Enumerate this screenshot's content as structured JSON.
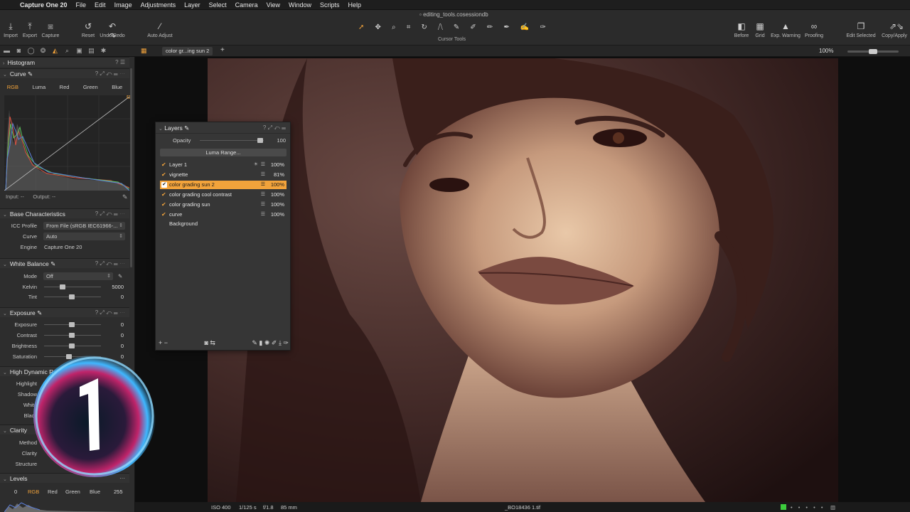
{
  "menubar": {
    "app": "Capture One 20",
    "items": [
      "File",
      "Edit",
      "Image",
      "Adjustments",
      "Layer",
      "Select",
      "Camera",
      "View",
      "Window",
      "Scripts",
      "Help"
    ]
  },
  "document_title": "editing_tools.cosessiondb",
  "toolbar": {
    "left": [
      {
        "label": "Import",
        "icon": "import-icon"
      },
      {
        "label": "Export",
        "icon": "export-icon"
      },
      {
        "label": "Capture",
        "icon": "camera-icon"
      },
      {
        "label": "Reset",
        "icon": "reset-icon"
      },
      {
        "label": "Undo/Redo",
        "icon": "undo-icon"
      },
      {
        "label": "Auto Adjust",
        "icon": "wand-icon"
      }
    ],
    "cursor_tools_label": "Cursor Tools",
    "right": [
      {
        "label": "Before",
        "icon": "before-icon"
      },
      {
        "label": "Grid",
        "icon": "grid-icon"
      },
      {
        "label": "Exp. Warning",
        "icon": "warning-icon"
      },
      {
        "label": "Proofing",
        "icon": "glasses-icon"
      },
      {
        "label": "Edit Selected",
        "icon": "stack-icon"
      },
      {
        "label": "Copy/Apply",
        "icon": "arrows-icon"
      }
    ]
  },
  "viewer": {
    "tab_label": "color gr...ing sun 2",
    "zoom": "100%"
  },
  "sidebar": {
    "histogram": "Histogram",
    "curve": {
      "title": "Curve",
      "tabs": [
        "RGB",
        "Luma",
        "Red",
        "Green",
        "Blue"
      ],
      "input_label": "Input:",
      "input_value": "--",
      "output_label": "Output:",
      "output_value": "--"
    },
    "base": {
      "title": "Base Characteristics",
      "icc_label": "ICC Profile",
      "icc_value": "From File (sRGB IEC61966-...",
      "curve_label": "Curve",
      "curve_value": "Auto",
      "engine_label": "Engine",
      "engine_value": "Capture One 20"
    },
    "white_balance": {
      "title": "White Balance",
      "mode_label": "Mode",
      "mode_value": "Off",
      "kelvin_label": "Kelvin",
      "kelvin_value": "5000",
      "tint_label": "Tint",
      "tint_value": "0"
    },
    "exposure": {
      "title": "Exposure",
      "rows": [
        {
          "label": "Exposure",
          "value": "0"
        },
        {
          "label": "Contrast",
          "value": "0"
        },
        {
          "label": "Brightness",
          "value": "0"
        },
        {
          "label": "Saturation",
          "value": "0"
        }
      ]
    },
    "hdr": {
      "title": "High Dynamic Range",
      "rows": [
        "Highlight",
        "Shadow",
        "White",
        "Black"
      ]
    },
    "clarity": {
      "title": "Clarity",
      "rows": [
        "Method",
        "Clarity",
        "Structure"
      ]
    },
    "levels": {
      "title": "Levels",
      "low": "0",
      "high": "255",
      "tabs": [
        "RGB",
        "Red",
        "Green",
        "Blue"
      ]
    }
  },
  "layers": {
    "title": "Layers",
    "opacity_label": "Opacity",
    "opacity_value": "100",
    "luma_range": "Luma Range...",
    "items": [
      {
        "name": "Layer 1",
        "pct": "100%"
      },
      {
        "name": "vignette",
        "pct": "81%"
      },
      {
        "name": "color grading sun 2",
        "pct": "100%"
      },
      {
        "name": "color grading cool contrast",
        "pct": "100%"
      },
      {
        "name": "color grading sun",
        "pct": "100%"
      },
      {
        "name": "curve",
        "pct": "100%"
      },
      {
        "name": "Background",
        "pct": ""
      }
    ]
  },
  "status": {
    "iso": "ISO 400",
    "shutter": "1/125 s",
    "aperture": "f/1.8",
    "focal": "85 mm",
    "filename": "_BO18436 1.tif"
  },
  "colors": {
    "accent": "#f2a33b",
    "panel": "#2d2d2d",
    "viewer_bg": "#0e0e0e"
  }
}
